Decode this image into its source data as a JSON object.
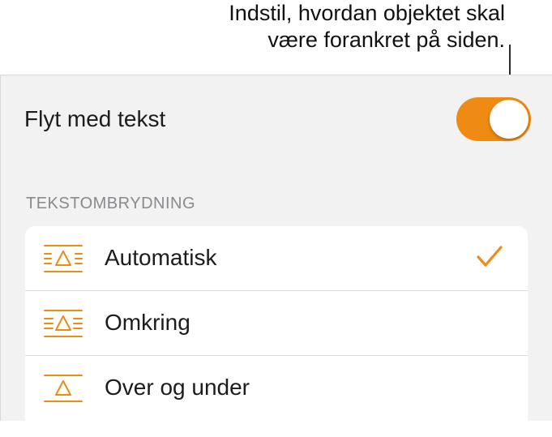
{
  "callout": {
    "line1": "Indstil, hvordan objektet skal",
    "line2": "være forankret på siden."
  },
  "flyt_med_tekst": {
    "label": "Flyt med tekst",
    "on": true
  },
  "section_header": "TEKSTOMBRYDNING",
  "wrap_options": [
    {
      "label": "Automatisk",
      "icon": "wrap-automatic-icon",
      "selected": true
    },
    {
      "label": "Omkring",
      "icon": "wrap-around-icon",
      "selected": false
    },
    {
      "label": "Over og under",
      "icon": "wrap-above-below-icon",
      "selected": false
    }
  ],
  "colors": {
    "accent": "#ef8b12",
    "panel_bg": "#f2f2f2",
    "section_header": "#8a8a8e"
  }
}
